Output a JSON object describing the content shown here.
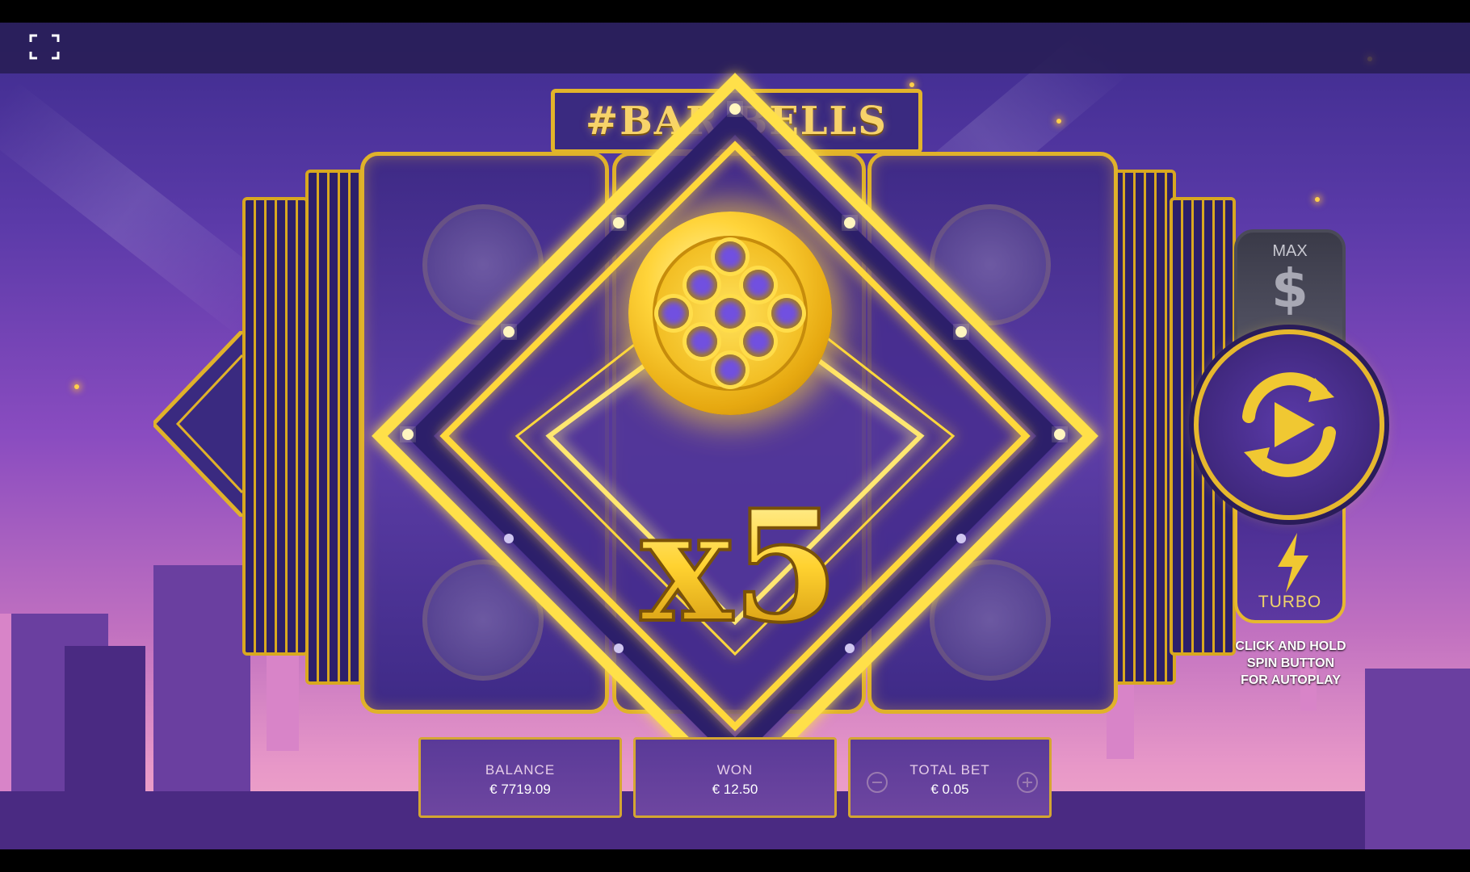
{
  "game": {
    "logo_text": "#BAR BELLS"
  },
  "hud": {
    "fullscreen_icon": "fullscreen-icon"
  },
  "win": {
    "multiplier_text": "x5",
    "symbol": "gold-coin-symbol"
  },
  "meters": {
    "balance_label": "BALANCE",
    "balance_value": "€ 7719.09",
    "won_label": "WON",
    "won_value": "€ 12.50",
    "total_bet_label": "TOTAL BET",
    "total_bet_value": "€ 0.05"
  },
  "controls": {
    "max_label": "MAX",
    "max_symbol": "$",
    "turbo_label": "TURBO",
    "autoplay_hint": [
      "CLICK AND HOLD",
      "SPIN BUTTON",
      "FOR AUTOPLAY"
    ]
  },
  "colors": {
    "gold": "#e6b82e",
    "purple": "#4a2e92",
    "sky_top": "#3a2a8a",
    "sky_bottom": "#f4b0c8"
  }
}
